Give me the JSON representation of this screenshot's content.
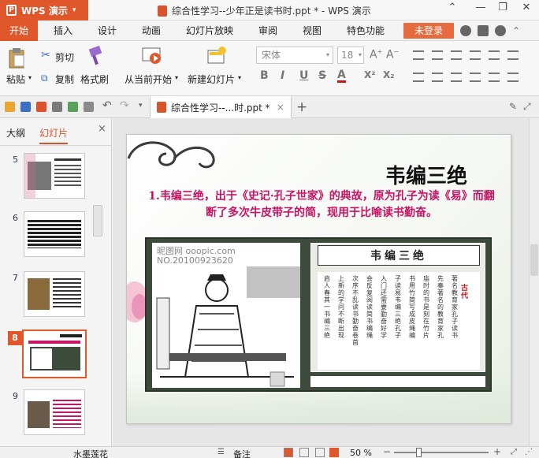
{
  "app": {
    "name": "WPS 演示",
    "window_title": "综合性学习--少年正是读书时.ppt * - WPS 演示"
  },
  "menu": {
    "tabs": [
      "开始",
      "插入",
      "设计",
      "动画",
      "幻灯片放映",
      "审阅",
      "视图",
      "特色功能"
    ],
    "active": "开始",
    "login_label": "未登录"
  },
  "ribbon": {
    "paste_label": "粘贴",
    "cut_label": "剪切",
    "copy_label": "复制",
    "format_painter_label": "格式刷",
    "from_current_label": "从当前开始",
    "new_slide_label": "新建幻灯片",
    "font_name": "宋体",
    "font_size": "18",
    "bold": "B",
    "italic": "I",
    "underline": "U",
    "strikethrough": "S",
    "font_color": "A",
    "superscript": "X²",
    "subscript": "X₂"
  },
  "doc_tab": {
    "label": "综合性学习--...时.ppt *",
    "close": "×"
  },
  "left_pane": {
    "tab_outline": "大纲",
    "tab_slides": "幻灯片",
    "close": "×",
    "slides": [
      {
        "num": "5"
      },
      {
        "num": "6"
      },
      {
        "num": "7"
      },
      {
        "num": "8",
        "selected": true
      },
      {
        "num": "9"
      }
    ]
  },
  "slide": {
    "title": "韦编三绝",
    "body": "1.韦编三绝，出于《史记·孔子世家》的典故，原为孔子为读《易》而翻断了多次牛皮带子的简，现用于比喻读书勤奋。",
    "image_watermark_1": "昵图网 ooopic.com",
    "image_watermark_2": "NO.20100923620",
    "image_title": "韦编三绝",
    "image_tag": "古代"
  },
  "statusbar": {
    "theme": "水墨莲花",
    "notes_label": "备注",
    "zoom": "50 %"
  },
  "colors": {
    "accent": "#e0572b",
    "body_text": "#c81464"
  }
}
